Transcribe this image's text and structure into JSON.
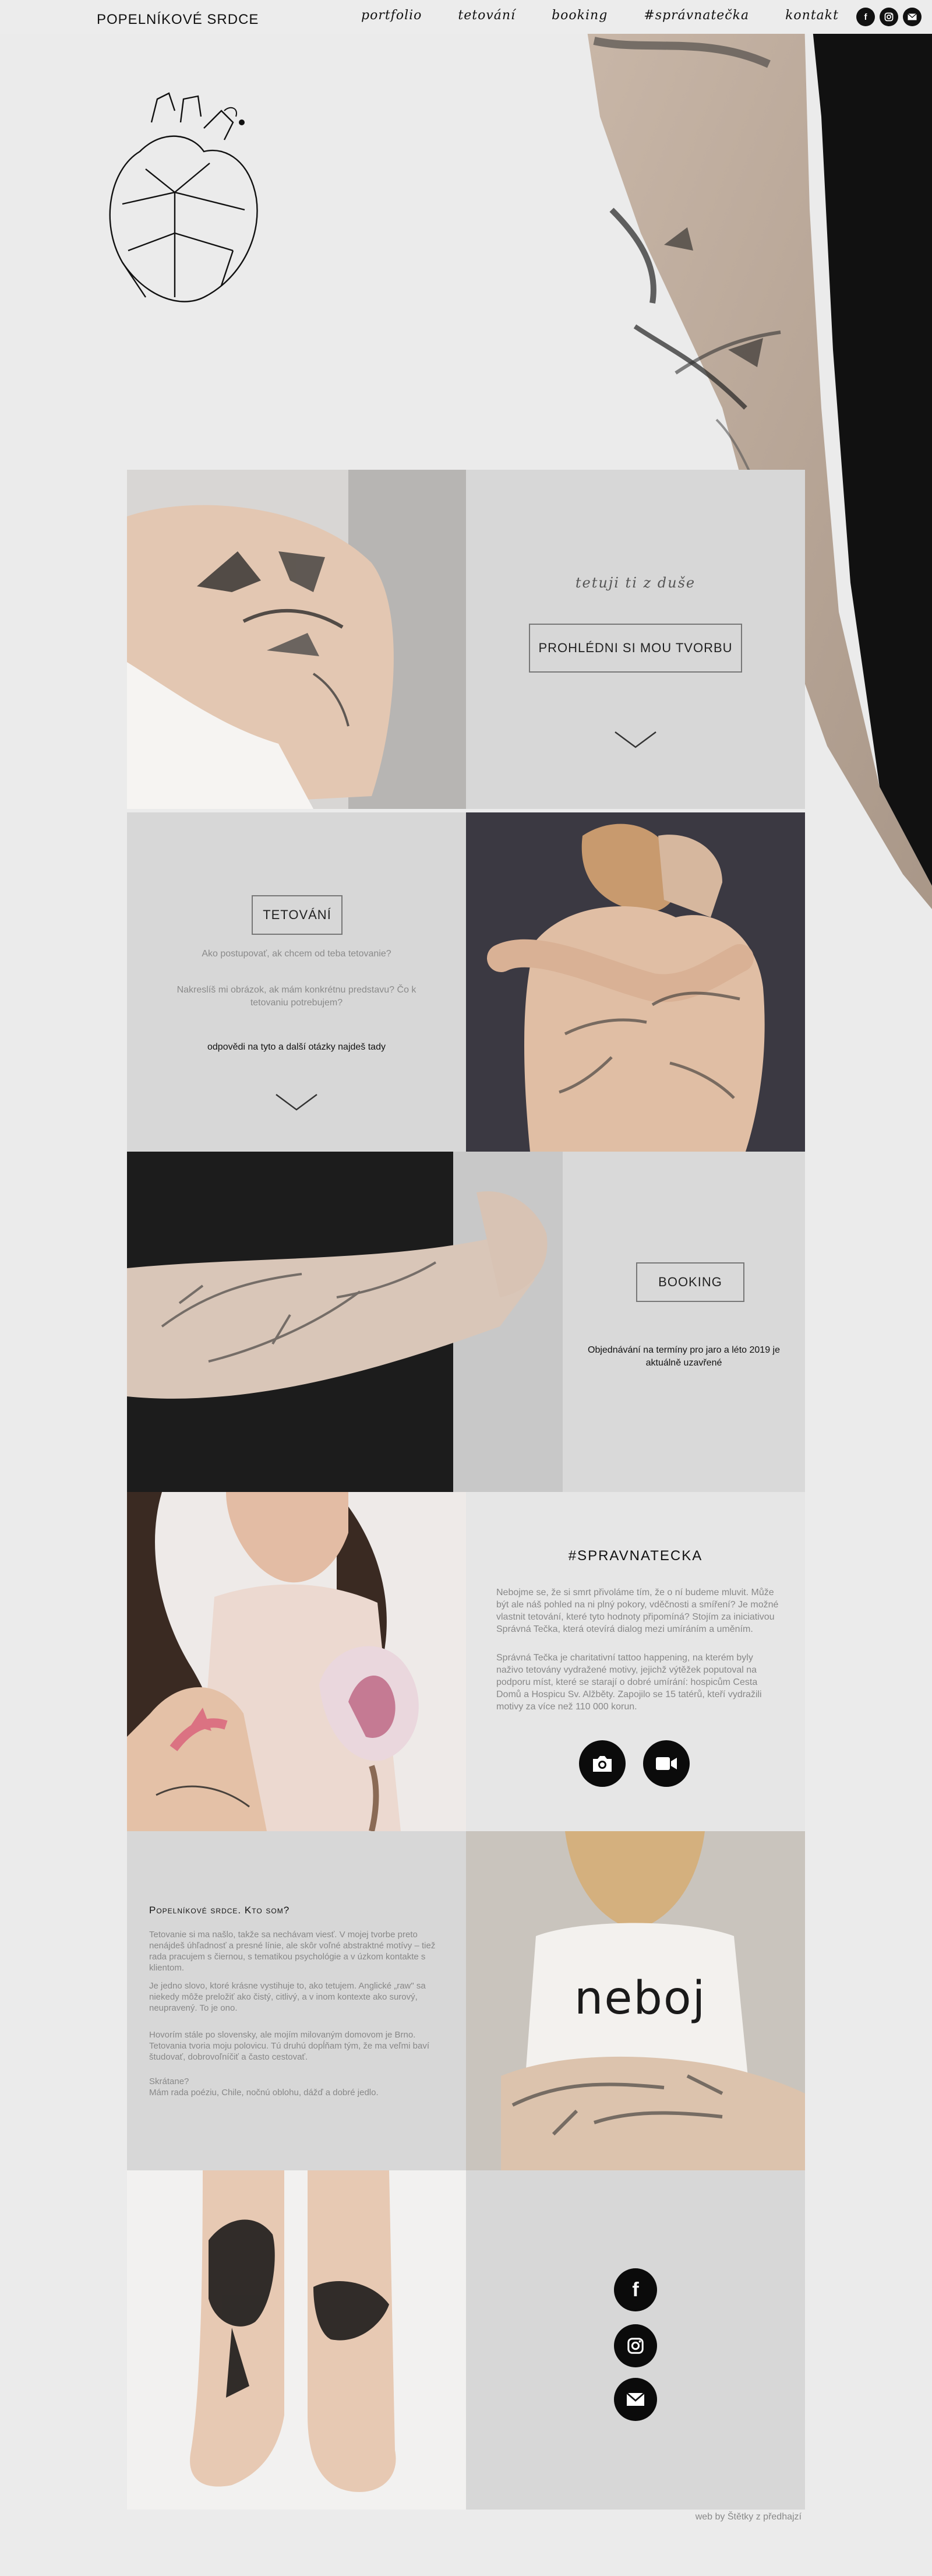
{
  "header": {
    "logo": "POPELNÍKOVÉ SRDCE",
    "nav": [
      "portfolio",
      "tetování",
      "booking",
      "#správnatečka",
      "kontakt"
    ],
    "social_icons": [
      "facebook-icon",
      "instagram-icon",
      "email-icon"
    ]
  },
  "hero": {
    "script_text": "tetuji ti z duše",
    "portfolio_button": "PROHLÉDNI SI MOU TVORBU"
  },
  "tetovani": {
    "button": "TETOVÁNÍ",
    "q1": "Ako postupovať, ak chcem od teba tetovanie?",
    "q2": "Nakreslíš mi obrázok, ak mám konkrétnu predstavu? Čo k tetovaniu potrebujem?",
    "answer_link": "odpovědi na tyto a další otázky najdeš tady"
  },
  "booking": {
    "button": "BOOKING",
    "info": "Objednávání na termíny pro jaro a léto 2019 je aktuálně uzavřené"
  },
  "spravnatecka": {
    "title": "#SPRAVNATECKA",
    "p1": "Nebojme se, že si smrt přivoláme tím, že o ní budeme mluvit. Může být ale náš pohled na ni plný pokory, vděčnosti a smíření? Je možné vlastnit tetování, které tyto hodnoty připomíná? Stojím za iniciativou Správná Tečka, která otevírá dialog mezi umíráním a uměním.",
    "p2": "Správná Tečka je charitativní tattoo happening, na kterém byly naživo tetovány vydražené motivy, jejichž výtěžek poputoval na podporu míst, které se starají o dobré umírání: hospicům Cesta Domů a Hospicu Sv. Alžběty. Zapojilo se 15 tatérů, kteří vydražili motivy za více než 110 000 korun.",
    "icons": [
      "camera-icon",
      "video-icon"
    ]
  },
  "about": {
    "title": "Popelníkové srdce. Kto som?",
    "p1": "Tetovanie si ma našlo, takže sa nechávam viesť. V mojej tvorbe preto nenájdeš úhľadnosť a presné línie, ale skôr voľné abstraktné motívy – tiež rada pracujem s čiernou, s tematikou psychológie a v úzkom kontakte s klientom.",
    "p2": "Je jedno slovo, ktoré krásne vystihuje to, ako tetujem. Anglické „raw\" sa niekedy môže preložiť ako čistý, citlivý, a v inom kontexte ako surový, neupravený. To je ono.",
    "p3": "Hovorím stále po slovensky, ale mojím milovaným domovom je Brno. Tetovania tvoria moju polovicu. Tú druhú dopĺňam tým, že ma veľmi baví študovať, dobrovoľníčiť a často cestovať.",
    "p4": "Skrátane?\nMám rada poéziu, Chile, nočnú oblohu, dážď a dobré jedlo.",
    "shirt_text": "neboj"
  },
  "contact": {
    "icons": [
      "facebook-icon",
      "instagram-icon",
      "email-icon"
    ]
  },
  "footer": {
    "credit": "web by Štětky z předhajzí"
  }
}
